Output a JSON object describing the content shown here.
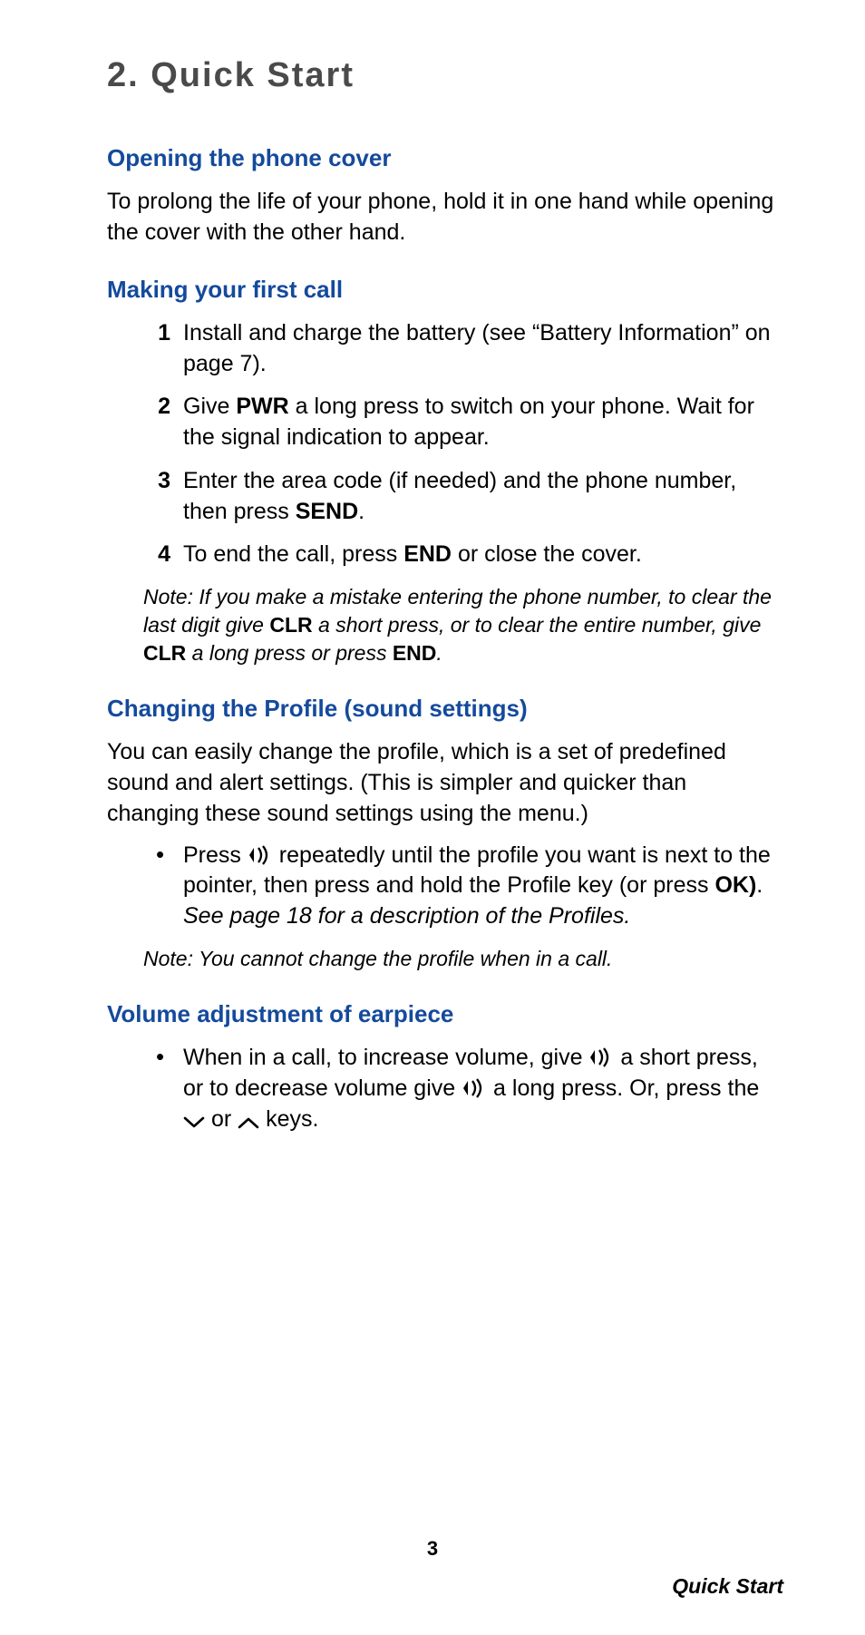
{
  "chapter": {
    "title": "2. Quick Start"
  },
  "section1": {
    "heading": "Opening the phone cover",
    "body": "To prolong the life of your phone, hold it in one hand while opening the cover with the other hand."
  },
  "section2": {
    "heading": "Making your first call",
    "steps": {
      "s1": "Install and charge the battery (see “Battery Information” on page 7).",
      "s2a": "Give ",
      "s2b": "PWR",
      "s2c": " a long press to switch on your phone. Wait for the signal indication to appear.",
      "s3a": "Enter the area code (if needed) and the phone number, then press ",
      "s3b": "SEND",
      "s3c": ".",
      "s4a": "To end the call, press ",
      "s4b": "END",
      "s4c": " or close the cover."
    },
    "note": {
      "p1": "Note: If you make a mistake entering the phone number, to clear the last digit give ",
      "b1": "CLR",
      "p2": " a short press, or to clear the entire number, give ",
      "b2": "CLR",
      "p3": " a long press or press ",
      "b3": "END",
      "p4": "."
    }
  },
  "section3": {
    "heading": "Changing the Profile (sound settings)",
    "body": "You can easily change the profile, which is a set of predefined sound and alert settings. (This is simpler and quicker than changing these sound settings using the menu.)",
    "bullet": {
      "p1": "Press ",
      "p2": " repeatedly until the profile you want is next to the pointer, then press and hold the Profile key (or press ",
      "b1": "OK)",
      "p3": ". ",
      "it": "See page 18 for a description of the Profiles."
    },
    "note": "Note: You cannot change the profile when in a call."
  },
  "section4": {
    "heading": "Volume adjustment of earpiece",
    "bullet": {
      "p1": "When in a call, to increase volume, give ",
      "p2": " a short press, or to decrease volume give ",
      "p3": " a long press. Or, press the ",
      "p4": " or ",
      "p5": " keys."
    }
  },
  "footer": {
    "page": "3",
    "label": "Quick Start"
  },
  "icons": {
    "profile": "profile-icon",
    "down": "chevron-down-icon",
    "up": "chevron-up-icon"
  }
}
